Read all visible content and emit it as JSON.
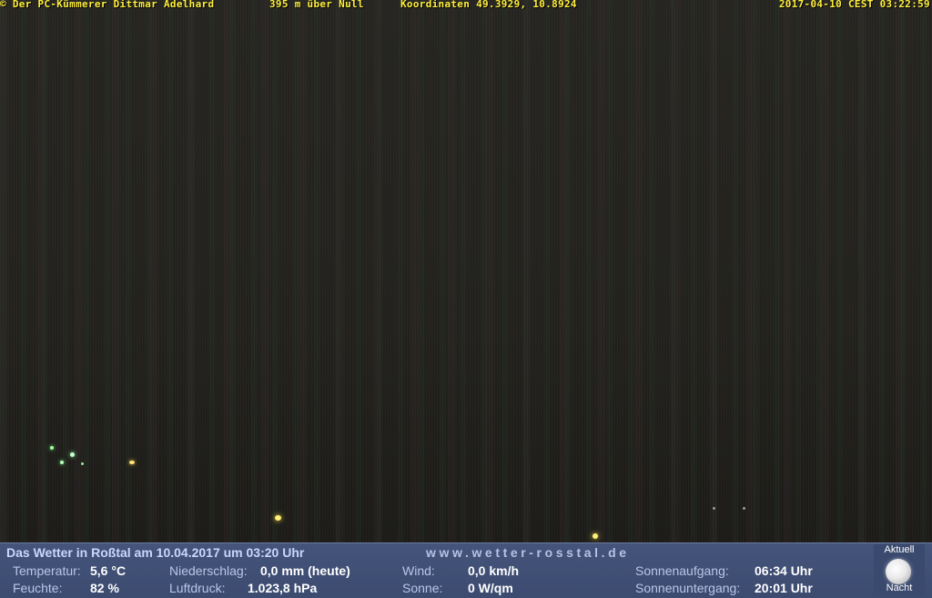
{
  "overlay": {
    "copyright": "© Der PC-Kümmerer Dittmar Adelhard",
    "altitude": "395 m über Null",
    "coordinates": "Koordinaten 49.3929, 10.8924",
    "timestamp": "2017-04-10 CEST 03:22:59"
  },
  "weather": {
    "title": "Das Wetter in Roßtal am 10.04.2017 um 03:20 Uhr",
    "site": "www.wetter-rosstal.de",
    "temperature": {
      "label": "Temperatur:",
      "value": "5,6 °C"
    },
    "humidity": {
      "label": "Feuchte:",
      "value": "82 %"
    },
    "precipitation": {
      "label": "Niederschlag:",
      "value": "0,0 mm (heute)"
    },
    "pressure": {
      "label": "Luftdruck:",
      "value": "1.023,8 hPa"
    },
    "wind": {
      "label": "Wind:",
      "value": "0,0 km/h"
    },
    "sun": {
      "label": "Sonne:",
      "value": "0 W/qm"
    },
    "sunrise": {
      "label": "Sonnenaufgang:",
      "value": "06:34 Uhr"
    },
    "sunset": {
      "label": "Sonnenuntergang:",
      "value": "20:01 Uhr"
    }
  },
  "moon": {
    "top_label": "Aktuell",
    "bottom_label": "Nacht",
    "icon": "full-moon-icon"
  },
  "colors": {
    "overlay_text": "#ffef3a",
    "panel_bg": "#3c4b70",
    "title_text": "#c9d6ff"
  }
}
